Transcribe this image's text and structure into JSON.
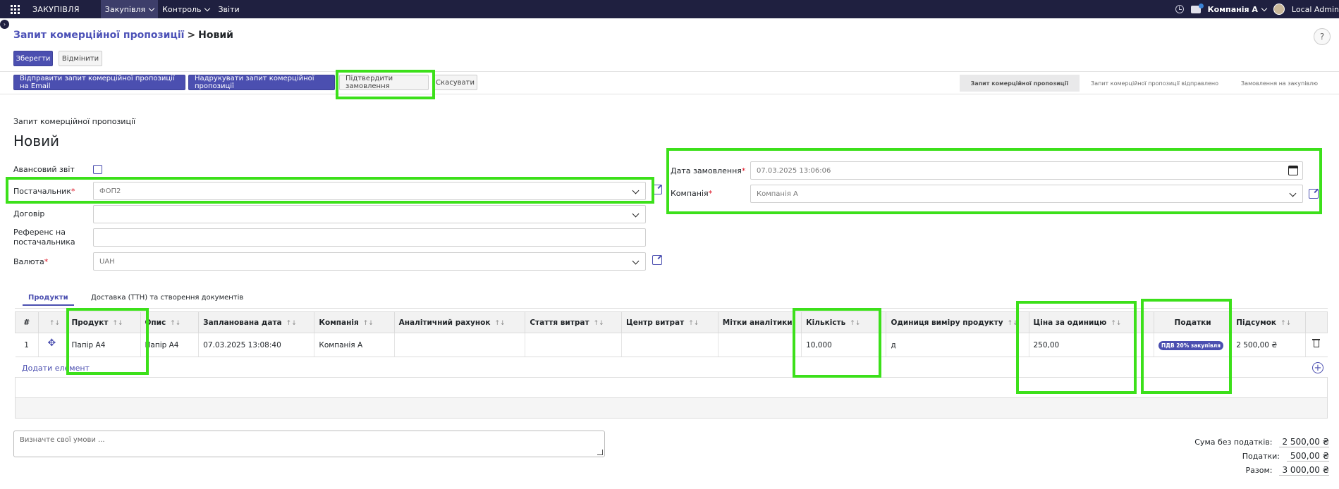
{
  "navbar": {
    "brand": "ЗАКУПІВЛЯ",
    "menu": [
      {
        "label": "Закупівля",
        "has_dropdown": true,
        "active": true
      },
      {
        "label": "Контроль",
        "has_dropdown": true,
        "active": false
      },
      {
        "label": "Звіти",
        "has_dropdown": false,
        "active": false
      }
    ],
    "company": "Компанія А",
    "user": "Local Admin",
    "icons": [
      "apps-grid-icon",
      "clock-icon",
      "chat-icon",
      "avatar"
    ]
  },
  "breadcrumb": {
    "parent": "Запит комерційної пропозиції",
    "separator": ">",
    "current": "Новий"
  },
  "help_label": "?",
  "actions": {
    "save": "Зберегти",
    "discard": "Відмінити"
  },
  "toolbar": {
    "send_email": "Відправити запит комерційної пропозиції на Email",
    "print_rfq": "Надрукувати запит комерційної пропозиції",
    "confirm_order": "Підтвердити замовлення",
    "cancel": "Скасувати"
  },
  "statusbar": {
    "stages": [
      {
        "label": "Запит комерційної пропозиції",
        "current": true
      },
      {
        "label": "Запит комерційної пропозиції відправлено",
        "current": false
      },
      {
        "label": "Замовлення на закупівлю",
        "current": false
      }
    ]
  },
  "form": {
    "record_type": "Запит комерційної пропозиції",
    "record_title": "Новий",
    "advance_report_label": "Авансовий звіт",
    "advance_report_checked": false,
    "vendor_label": "Постачальник",
    "vendor_value": "ФОП2",
    "contract_label": "Договір",
    "contract_value": "",
    "vendor_ref_label": "Референс на постачальника",
    "vendor_ref_value": "",
    "currency_label": "Валюта",
    "currency_value": "UAH",
    "order_date_label": "Дата замовлення",
    "order_date_value": "07.03.2025 13:06:06",
    "company_label": "Компанія",
    "company_value": "Компанія А",
    "required_mark": "*"
  },
  "tabs": [
    {
      "label": "Продукти",
      "active": true
    },
    {
      "label": "Доставка (ТТН) та створення документів",
      "active": false
    }
  ],
  "table": {
    "headers": [
      "#",
      "",
      "Продукт",
      "Опис",
      "Запланована дата",
      "Компанія",
      "Аналітичний рахунок",
      "Стаття витрат",
      "Центр витрат",
      "Мітки аналітики",
      "Кількість",
      "Одиниця виміру продукту",
      "Ціна за одиницю",
      "Податки",
      "Підсумок",
      ""
    ],
    "sort_glyph": "↑↓",
    "rows": [
      {
        "num": "1",
        "product": "Папір А4",
        "description": "Папір А4",
        "planned_date": "07.03.2025 13:08:40",
        "company": "Компанія А",
        "analytic_account": "",
        "expense_item": "",
        "cost_center": "",
        "analytic_tags": "",
        "quantity": "10,000",
        "uom": "д",
        "unit_price": "250,00",
        "taxes": "ПДВ 20% закупівля",
        "subtotal": "2 500,00 ₴"
      }
    ],
    "add_line": "Додати елемент",
    "add_icon": "+"
  },
  "notes_placeholder": "Визначте свої умови ...",
  "totals": {
    "untaxed_label": "Сума без податків:",
    "untaxed_value": "2 500,00 ₴",
    "taxes_label": "Податки:",
    "taxes_value": "500,00 ₴",
    "total_label": "Разом:",
    "total_value": "3 000,00 ₴"
  },
  "colors": {
    "navbar": "#1f2040",
    "accent": "#4b4fb0",
    "highlight": "#3ce01a"
  }
}
